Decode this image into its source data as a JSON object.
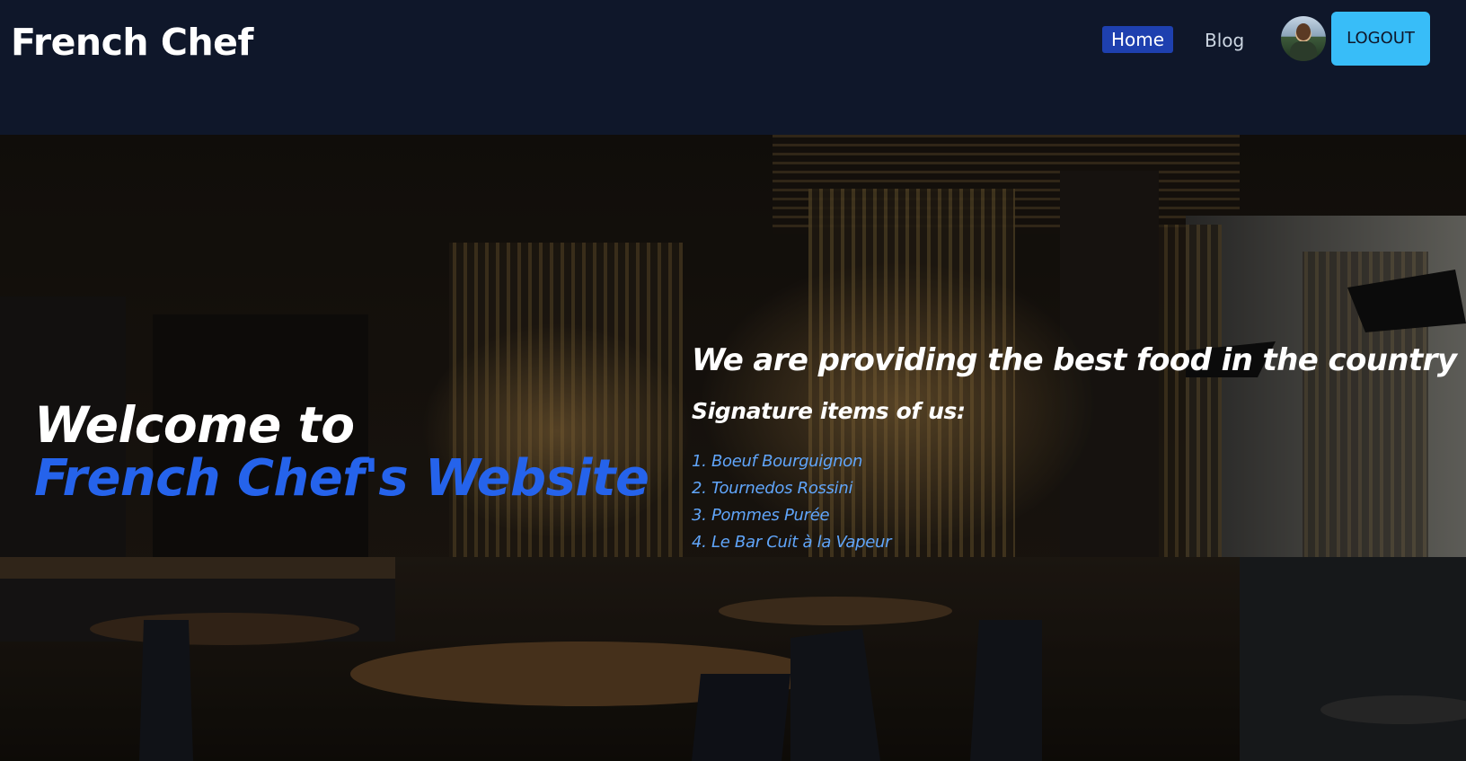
{
  "navbar": {
    "brand": "French Chef",
    "links": [
      {
        "label": "Home",
        "active": true
      },
      {
        "label": "Blog",
        "active": false
      }
    ],
    "logout_label": "LOGOUT"
  },
  "hero": {
    "welcome": "Welcome to",
    "welcome_accent": "French Chef's Website",
    "tagline": "We are providing the best food in the country",
    "signature_heading": "Signature items of us:",
    "signature_items": [
      "1. Boeuf Bourguignon",
      "2. Tournedos Rossini",
      "3. Pommes Purée",
      "4. Le Bar Cuit à la Vapeur"
    ]
  },
  "colors": {
    "navbar_bg": "#0f172a",
    "active_link_bg": "#1e40af",
    "logout_bg": "#38bdf8",
    "accent_text": "#2563eb",
    "list_text": "#60a5fa"
  },
  "icons": {
    "avatar": "user-avatar-photo",
    "hero_background": "restaurant-interior-photo"
  }
}
